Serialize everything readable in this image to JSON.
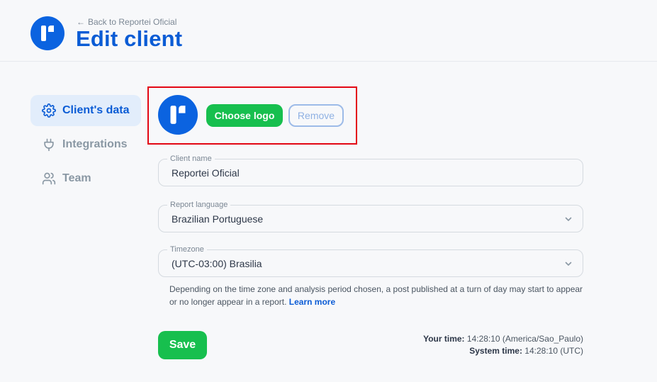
{
  "header": {
    "back_link": "Back to Reportei Oficial",
    "title": "Edit client"
  },
  "sidebar": {
    "items": [
      {
        "label": "Client's data",
        "icon": "gear-icon",
        "active": true
      },
      {
        "label": "Integrations",
        "icon": "plug-icon",
        "active": false
      },
      {
        "label": "Team",
        "icon": "users-icon",
        "active": false
      }
    ]
  },
  "logo_section": {
    "choose_label": "Choose logo",
    "remove_label": "Remove"
  },
  "form": {
    "client_name": {
      "label": "Client name",
      "value": "Reportei Oficial"
    },
    "report_language": {
      "label": "Report language",
      "value": "Brazilian Portuguese"
    },
    "timezone": {
      "label": "Timezone",
      "value": "(UTC-03:00) Brasilia"
    },
    "hint_text": "Depending on the time zone and analysis period chosen, a post published at a turn of day may start to appear or no longer appear in a report.",
    "learn_more": "Learn more",
    "save_label": "Save"
  },
  "times": {
    "your_time_label": "Your time:",
    "your_time_value": "14:28:10 (America/Sao_Paulo)",
    "system_time_label": "System time:",
    "system_time_value": "14:28:10 (UTC)"
  },
  "colors": {
    "brand_blue": "#0b5cd5",
    "success_green": "#17bf4e",
    "highlight_red": "#e30613"
  }
}
